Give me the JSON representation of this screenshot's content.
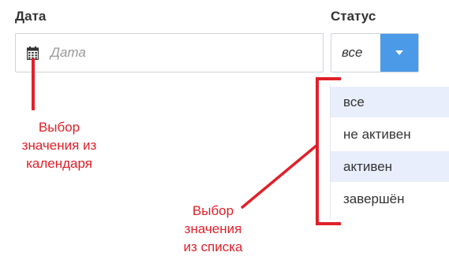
{
  "date_field": {
    "label": "Дата",
    "placeholder": "Дата",
    "icon": "calendar-icon"
  },
  "status_field": {
    "label": "Статус",
    "selected": "все",
    "icon": "caret-down-icon"
  },
  "dropdown": {
    "options": [
      {
        "label": "все",
        "highlighted": true
      },
      {
        "label": "не активен",
        "highlighted": false
      },
      {
        "label": "активен",
        "highlighted": true
      },
      {
        "label": "завершён",
        "highlighted": false
      }
    ]
  },
  "annotations": {
    "calendar_note": [
      "Выбор",
      "значения из",
      "календаря"
    ],
    "list_note": [
      "Выбор",
      "значения",
      "из списка"
    ]
  },
  "colors": {
    "accent": "#4a9ae8",
    "annotation": "#e0202a",
    "highlight": "#e8eefb"
  }
}
